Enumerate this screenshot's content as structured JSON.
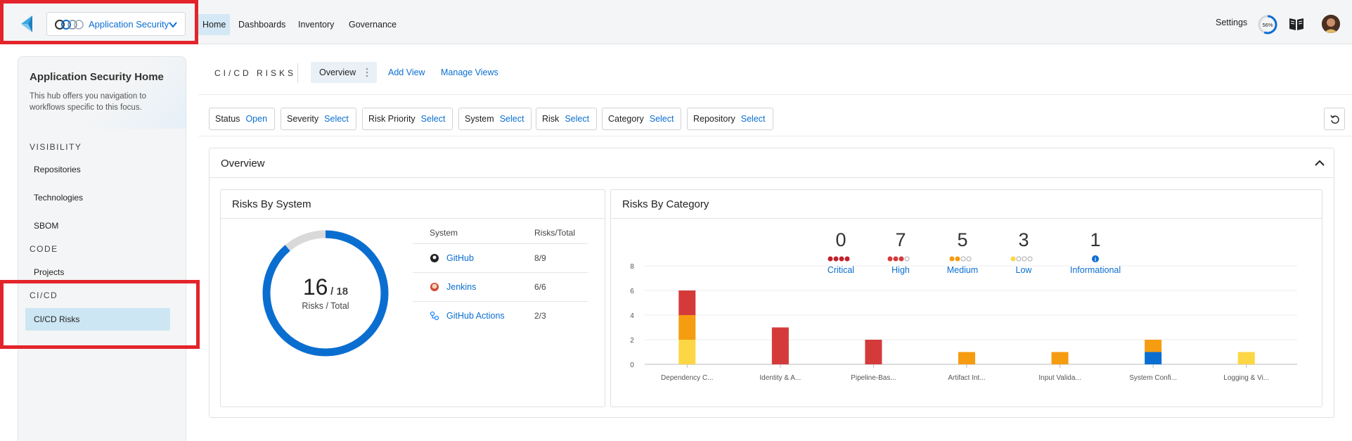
{
  "colors": {
    "accent": "#0a6ed1",
    "critical": "#d53a3a",
    "high": "#d53a3a",
    "medium": "#f59c10",
    "low": "#fcd645",
    "informational": "#0a6ed1",
    "highlight_box": "#e3242b"
  },
  "topnav": {
    "hub_label": "Application Security",
    "items": [
      "Home",
      "Dashboards",
      "Inventory",
      "Governance"
    ],
    "settings": "Settings",
    "progress": "56%",
    "progress_value": 0.56
  },
  "sidebar": {
    "title": "Application Security Home",
    "description": "This hub offers you navigation to workflows specific to this focus.",
    "sections": [
      {
        "label": "VISIBILITY",
        "items": [
          "Repositories",
          "Technologies",
          "SBOM"
        ]
      },
      {
        "label": "CODE",
        "items": [
          "Projects"
        ]
      },
      {
        "label": "CI/CD",
        "items": [
          "CI/CD Risks"
        ]
      }
    ]
  },
  "header": {
    "title": "CI/CD RISKS",
    "tab": "Overview",
    "add_view": "Add View",
    "manage_views": "Manage Views"
  },
  "filters": [
    {
      "label": "Status",
      "value": "Open"
    },
    {
      "label": "Severity",
      "value": "Select"
    },
    {
      "label": "Risk Priority",
      "value": "Select"
    },
    {
      "label": "System",
      "value": "Select"
    },
    {
      "label": "Risk",
      "value": "Select"
    },
    {
      "label": "Category",
      "value": "Select"
    },
    {
      "label": "Repository",
      "value": "Select"
    }
  ],
  "overview": {
    "title": "Overview",
    "risks_by_system": {
      "title": "Risks By System",
      "risks": "16",
      "total": "/ 18",
      "risks_value": 16,
      "total_value": 18,
      "caption": "Risks / Total",
      "col_system": "System",
      "col_ratio": "Risks/Total",
      "rows": [
        {
          "name": "GitHub",
          "ratio": "8/9",
          "icon": "github-icon"
        },
        {
          "name": "Jenkins",
          "ratio": "6/6",
          "icon": "jenkins-icon"
        },
        {
          "name": "GitHub Actions",
          "ratio": "2/3",
          "icon": "github-actions-icon"
        }
      ]
    },
    "risks_by_category": {
      "title": "Risks By Category",
      "severities": [
        {
          "count": "0",
          "label": "Critical",
          "filled": 4,
          "color": "#c0202b"
        },
        {
          "count": "7",
          "label": "High",
          "filled": 3,
          "color": "#d53a3a"
        },
        {
          "count": "5",
          "label": "Medium",
          "filled": 2,
          "color": "#f59c10"
        },
        {
          "count": "3",
          "label": "Low",
          "filled": 1,
          "color": "#fcd645"
        },
        {
          "count": "1",
          "label": "Informational",
          "filled": 0,
          "color": "#0a6ed1"
        }
      ]
    }
  },
  "chart_data": {
    "type": "bar",
    "stacked": true,
    "categories": [
      "Dependency C...",
      "Identity & A...",
      "Pipeline-Bas...",
      "Artifact Int...",
      "Input Valida...",
      "System Confi...",
      "Logging & Vi..."
    ],
    "series": [
      {
        "name": "Informational",
        "color": "#0a6ed1",
        "values": [
          0,
          0,
          0,
          0,
          0,
          1,
          0
        ]
      },
      {
        "name": "Low",
        "color": "#fcd645",
        "values": [
          2,
          0,
          0,
          0,
          0,
          0,
          1
        ]
      },
      {
        "name": "Medium",
        "color": "#f59c10",
        "values": [
          2,
          0,
          0,
          1,
          1,
          1,
          0
        ]
      },
      {
        "name": "High",
        "color": "#d53a3a",
        "values": [
          2,
          3,
          2,
          0,
          0,
          0,
          0
        ]
      }
    ],
    "yticks": [
      0,
      2,
      4,
      6,
      8
    ],
    "ylim": [
      0,
      8
    ],
    "grid": true
  }
}
